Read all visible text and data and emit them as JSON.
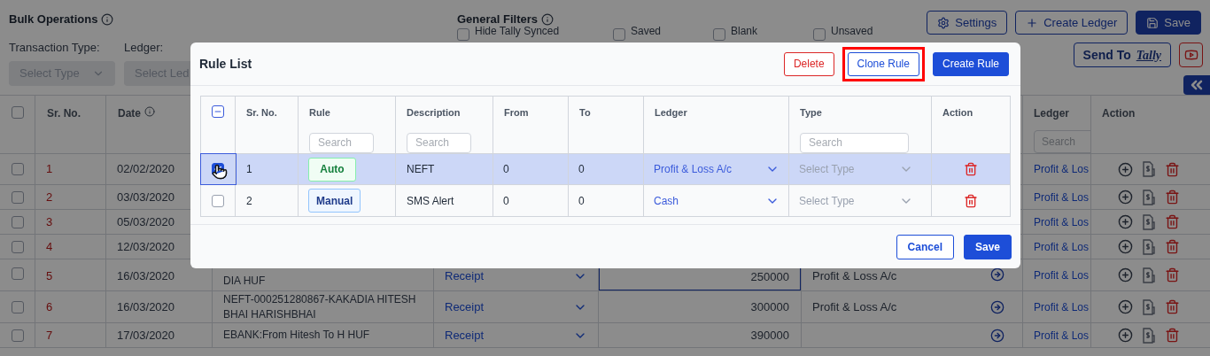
{
  "page": {
    "title": "Bulk Operations",
    "filters_title": "General Filters",
    "filters": [
      {
        "label": "Hide Tally Synced",
        "checked": false
      },
      {
        "label": "Saved",
        "checked": false
      },
      {
        "label": "Blank",
        "checked": false
      },
      {
        "label": "Unsaved",
        "checked": false
      }
    ],
    "buttons": [
      {
        "label": "Settings",
        "kind": "settings"
      },
      {
        "label": "Create Ledger",
        "kind": "add"
      },
      {
        "label": "Save",
        "kind": "save"
      }
    ],
    "transaction_type": {
      "label": "Transaction Type:",
      "placeholder": "Select Type"
    },
    "ledger": {
      "label": "Ledger:",
      "placeholder": "Select Led"
    },
    "send_to": {
      "label": "Send To",
      "logo": "Tally"
    }
  },
  "table": {
    "select_all": {
      "checked": false
    },
    "columns": [
      "Sr. No.",
      "Date"
    ],
    "right_columns": [
      "Ledger",
      "Action"
    ],
    "ledger_search": {
      "placeholder": "Search"
    },
    "rows": [
      {
        "sr": "1",
        "date": "02/02/2020",
        "ledger": "Profit & Los",
        "checked": false,
        "kind": "tall"
      },
      {
        "sr": "2",
        "date": "03/03/2020",
        "ledger": "Profit & Los",
        "checked": false
      },
      {
        "sr": "3",
        "date": "05/03/2020",
        "ledger": "Profit & Los",
        "checked": false
      },
      {
        "sr": "4",
        "date": "12/03/2020",
        "ledger": "Profit & Los",
        "checked": false
      },
      {
        "sr": "5",
        "date": "16/03/2020",
        "description": "DIA HUF",
        "type": "Receipt",
        "amount": "250000",
        "suggested": "Profit & Loss A/c",
        "ledger": "Profit & Los",
        "checked": false,
        "focused": true,
        "kind": "covered"
      },
      {
        "sr": "6",
        "date": "16/03/2020",
        "description": "NEFT-000251280867-KAKADIA HITESH BHAI HARISHBHAI",
        "type": "Receipt",
        "amount": "300000",
        "suggested": "Profit & Loss A/c",
        "ledger": "Profit & Los",
        "checked": false,
        "focused": false
      },
      {
        "sr": "7",
        "date": "17/03/2020",
        "description": "EBANK:From Hitesh To H HUF",
        "type": "Receipt",
        "amount": "390000",
        "ledger": "Profit & Los",
        "checked": false,
        "focused": false
      }
    ]
  },
  "modal": {
    "title": "Rule List",
    "actions": [
      {
        "label": "Delete",
        "kind": "danger",
        "highlighted": false
      },
      {
        "label": "Clone Rule",
        "kind": "outline",
        "highlighted": true
      },
      {
        "label": "Create Rule",
        "kind": "primary",
        "highlighted": false
      }
    ],
    "columns": [
      {
        "label": "Sr. No."
      },
      {
        "label": "Rule",
        "placeholder": "Search"
      },
      {
        "label": "Description",
        "placeholder": "Search"
      },
      {
        "label": "From"
      },
      {
        "label": "To"
      },
      {
        "label": "Ledger"
      },
      {
        "label": "Type",
        "placeholder": "Search"
      },
      {
        "label": "Action"
      }
    ],
    "header_checkbox": {
      "indeterminate": true
    },
    "rows": [
      {
        "sr": "1",
        "rule": "Auto",
        "kind": "auto",
        "description": "NEFT",
        "from": "0",
        "to": "0",
        "ledger": "Profit & Loss A/c",
        "type_placeholder": "Select Type",
        "selected": true,
        "checked": true
      },
      {
        "sr": "2",
        "rule": "Manual",
        "kind": "manual",
        "description": "SMS Alert",
        "from": "0",
        "to": "0",
        "ledger": "Cash",
        "type_placeholder": "Select Type",
        "selected": false,
        "checked": false
      }
    ],
    "footer": [
      {
        "label": "Cancel",
        "kind": "outline"
      },
      {
        "label": "Save",
        "kind": "primary"
      }
    ]
  }
}
